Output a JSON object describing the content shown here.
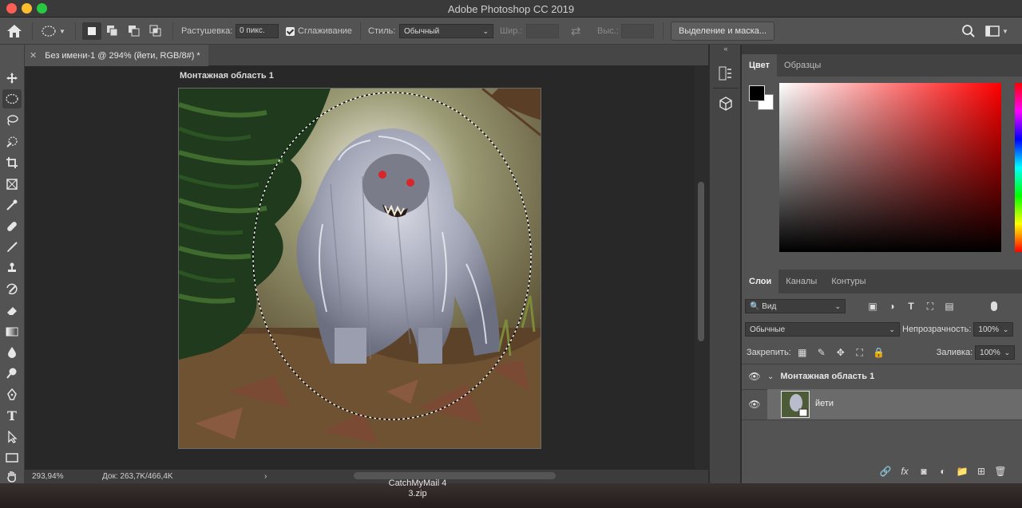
{
  "window": {
    "title": "Adobe Photoshop CC 2019"
  },
  "options_bar": {
    "feather_label": "Растушевка:",
    "feather_value": "0 пикс.",
    "antialias_label": "Сглаживание",
    "style_label": "Стиль:",
    "style_value": "Обычный",
    "width_label": "Шир.:",
    "height_label": "Выс.:",
    "mask_button": "Выделение и маска..."
  },
  "document": {
    "tab_title": "Без имени-1 @ 294% (йети, RGB/8#) *",
    "artboard_label": "Монтажная область 1",
    "zoom": "293,94%",
    "doc_size": "Док: 263,7K/466,4K"
  },
  "color_panel": {
    "tabs": [
      "Цвет",
      "Образцы"
    ],
    "foreground": "#000000",
    "background": "#ffffff"
  },
  "layers_panel": {
    "tabs": [
      "Слои",
      "Каналы",
      "Контуры"
    ],
    "filter_value": "Вид",
    "blend_mode": "Обычные",
    "opacity_label": "Непрозрачность:",
    "opacity_value": "100%",
    "lock_label": "Закрепить:",
    "fill_label": "Заливка:",
    "fill_value": "100%",
    "layers": [
      {
        "name": "Монтажная область 1",
        "type": "artboard"
      },
      {
        "name": "йети",
        "type": "smart-object"
      }
    ]
  },
  "dock": {
    "item_line1": "CatchMyMail 4",
    "item_line2": "3.zip"
  }
}
